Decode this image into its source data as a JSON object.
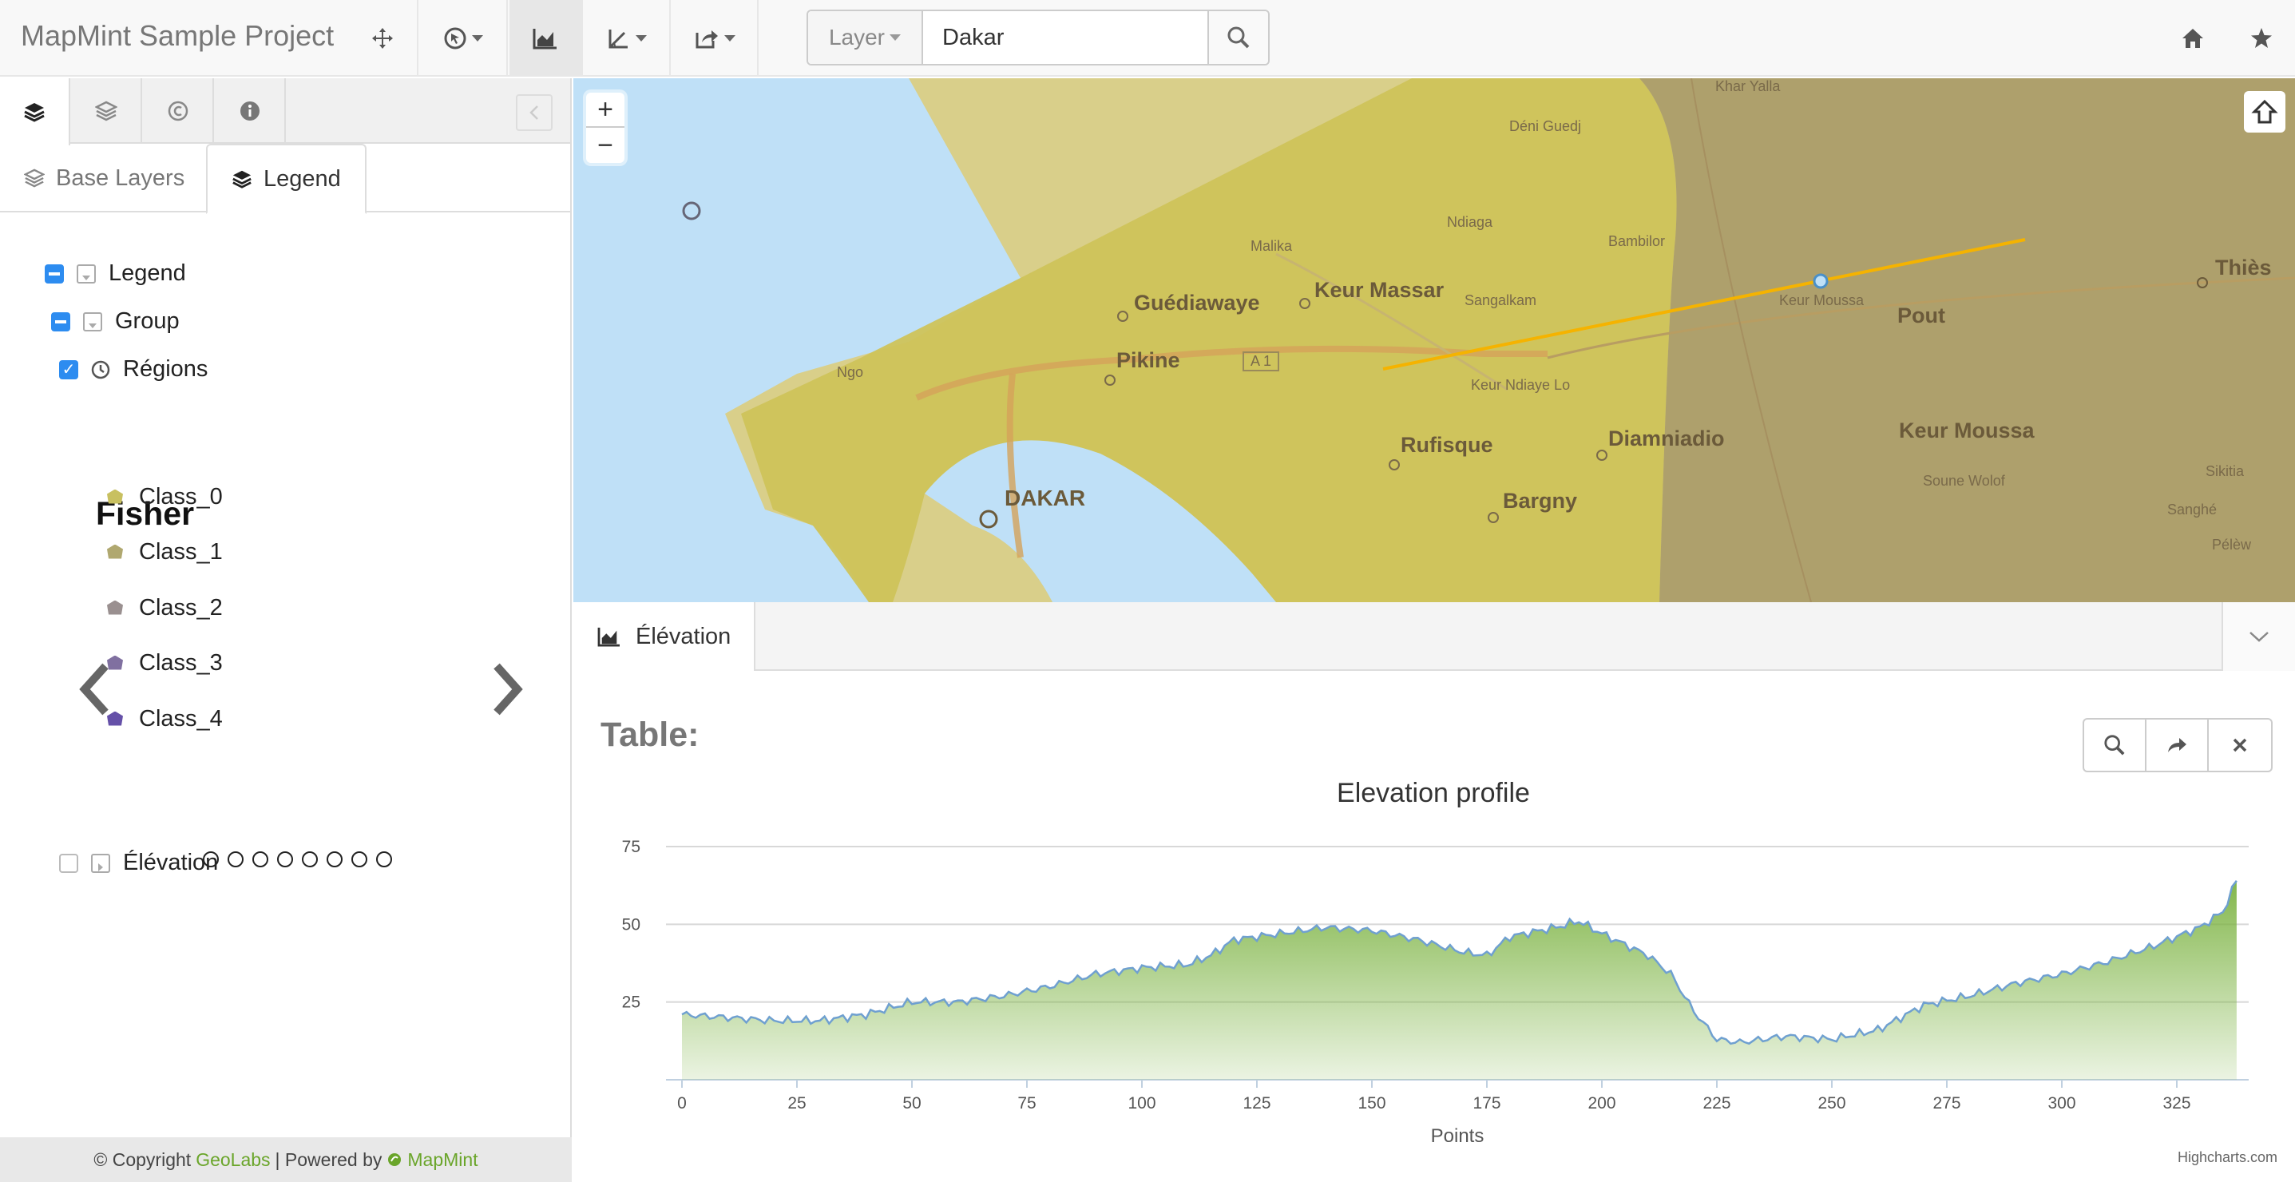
{
  "app": {
    "title": "MapMint Sample Project"
  },
  "search": {
    "layer_label": "Layer",
    "value": "Dakar"
  },
  "navbar_icons": [
    "move-icon",
    "select-icon",
    "chart-icon",
    "measure-icon",
    "share-icon",
    "home-icon",
    "star-icon"
  ],
  "sidebar": {
    "subtabs": {
      "base_layers": "Base Layers",
      "legend": "Legend"
    },
    "tree": {
      "legend": "Legend",
      "group": "Group",
      "regions": "Régions",
      "elevation": "Élévation"
    },
    "legend_title": "Fisher",
    "classes": [
      {
        "label": "Class_0",
        "color": "#c8c060"
      },
      {
        "label": "Class_1",
        "color": "#b0a870"
      },
      {
        "label": "Class_2",
        "color": "#9a9090"
      },
      {
        "label": "Class_3",
        "color": "#8070a0"
      },
      {
        "label": "Class_4",
        "color": "#6550a8"
      }
    ],
    "footer": {
      "copyright": "© Copyright",
      "geolabs": "GeoLabs",
      "powered": "| Powered by",
      "mapmint": "MapMint"
    }
  },
  "map": {
    "labels_major": [
      "DAKAR",
      "Guédiawaye",
      "Keur Massar",
      "Pikine",
      "Rufisque",
      "Bargny",
      "Diamniadio",
      "Pout",
      "Keur Moussa",
      "Thiès"
    ],
    "labels_minor": [
      "Khar Yalla",
      "Déni Guedj",
      "Ndiaga",
      "Bambilor",
      "Malika",
      "Sangalkam",
      "Keur Moussa",
      "Keur Ndiaye Lo",
      "Soune Wolof",
      "Sikitia",
      "Sanghé",
      "Pélèw",
      "Ngo",
      "A 1"
    ]
  },
  "panel": {
    "tab_label": "Élévation",
    "table_title": "Table:"
  },
  "chart_data": {
    "type": "area",
    "title": "Elevation profile",
    "xlabel": "Points",
    "ylabel": "",
    "xlim": [
      0,
      340
    ],
    "ylim": [
      0,
      75
    ],
    "x_ticks": [
      0,
      25,
      50,
      75,
      100,
      125,
      150,
      175,
      200,
      225,
      250,
      275,
      300,
      325
    ],
    "y_ticks": [
      25,
      50,
      75
    ],
    "credits": "Highcharts.com",
    "color": "#7cb342",
    "series": [
      {
        "x": [
          0,
          10,
          20,
          30,
          40,
          50,
          60,
          70,
          80,
          90,
          100,
          110,
          115,
          120,
          130,
          140,
          150,
          160,
          170,
          175,
          180,
          190,
          195,
          200,
          210,
          215,
          220,
          225,
          230,
          240,
          250,
          260,
          270,
          280,
          290,
          300,
          310,
          320,
          330,
          335,
          338
        ],
        "values": [
          21,
          20,
          19,
          19,
          21,
          25,
          25,
          27,
          30,
          34,
          36,
          37,
          40,
          45,
          47,
          49,
          48,
          45,
          41,
          40,
          46,
          49,
          51,
          47,
          40,
          34,
          22,
          13,
          12,
          14,
          13,
          16,
          24,
          27,
          31,
          34,
          38,
          43,
          49,
          54,
          64
        ]
      }
    ]
  }
}
